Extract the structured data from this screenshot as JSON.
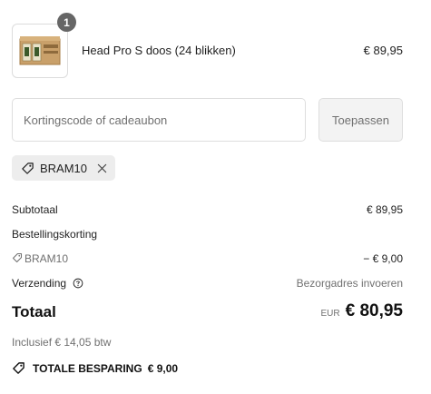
{
  "cart": {
    "item": {
      "name": "Head Pro S doos (24 blikken)",
      "price": "€ 89,95",
      "quantity": "1"
    }
  },
  "discount": {
    "placeholder": "Kortingscode of cadeaubon",
    "apply_label": "Toepassen",
    "applied_code": "BRAM10"
  },
  "summary": {
    "subtotal_label": "Subtotaal",
    "subtotal_value": "€ 89,95",
    "order_discount_label": "Bestellingskorting",
    "discount_code": "BRAM10",
    "discount_value": "− € 9,00",
    "shipping_label": "Verzending",
    "shipping_value": "Bezorgadres invoeren",
    "total_label": "Totaal",
    "currency": "EUR",
    "total_value": "€ 80,95",
    "tax_note": "Inclusief € 14,05 btw",
    "savings_label": "TOTALE BESPARING",
    "savings_value": "€ 9,00"
  },
  "icons": {
    "tag": "tag-icon",
    "close": "close-icon",
    "help": "help-circle-icon"
  },
  "colors": {
    "badge": "#666666",
    "chip_bg": "#ededed",
    "muted_text": "#707070",
    "button_bg": "#f3f3f3"
  }
}
